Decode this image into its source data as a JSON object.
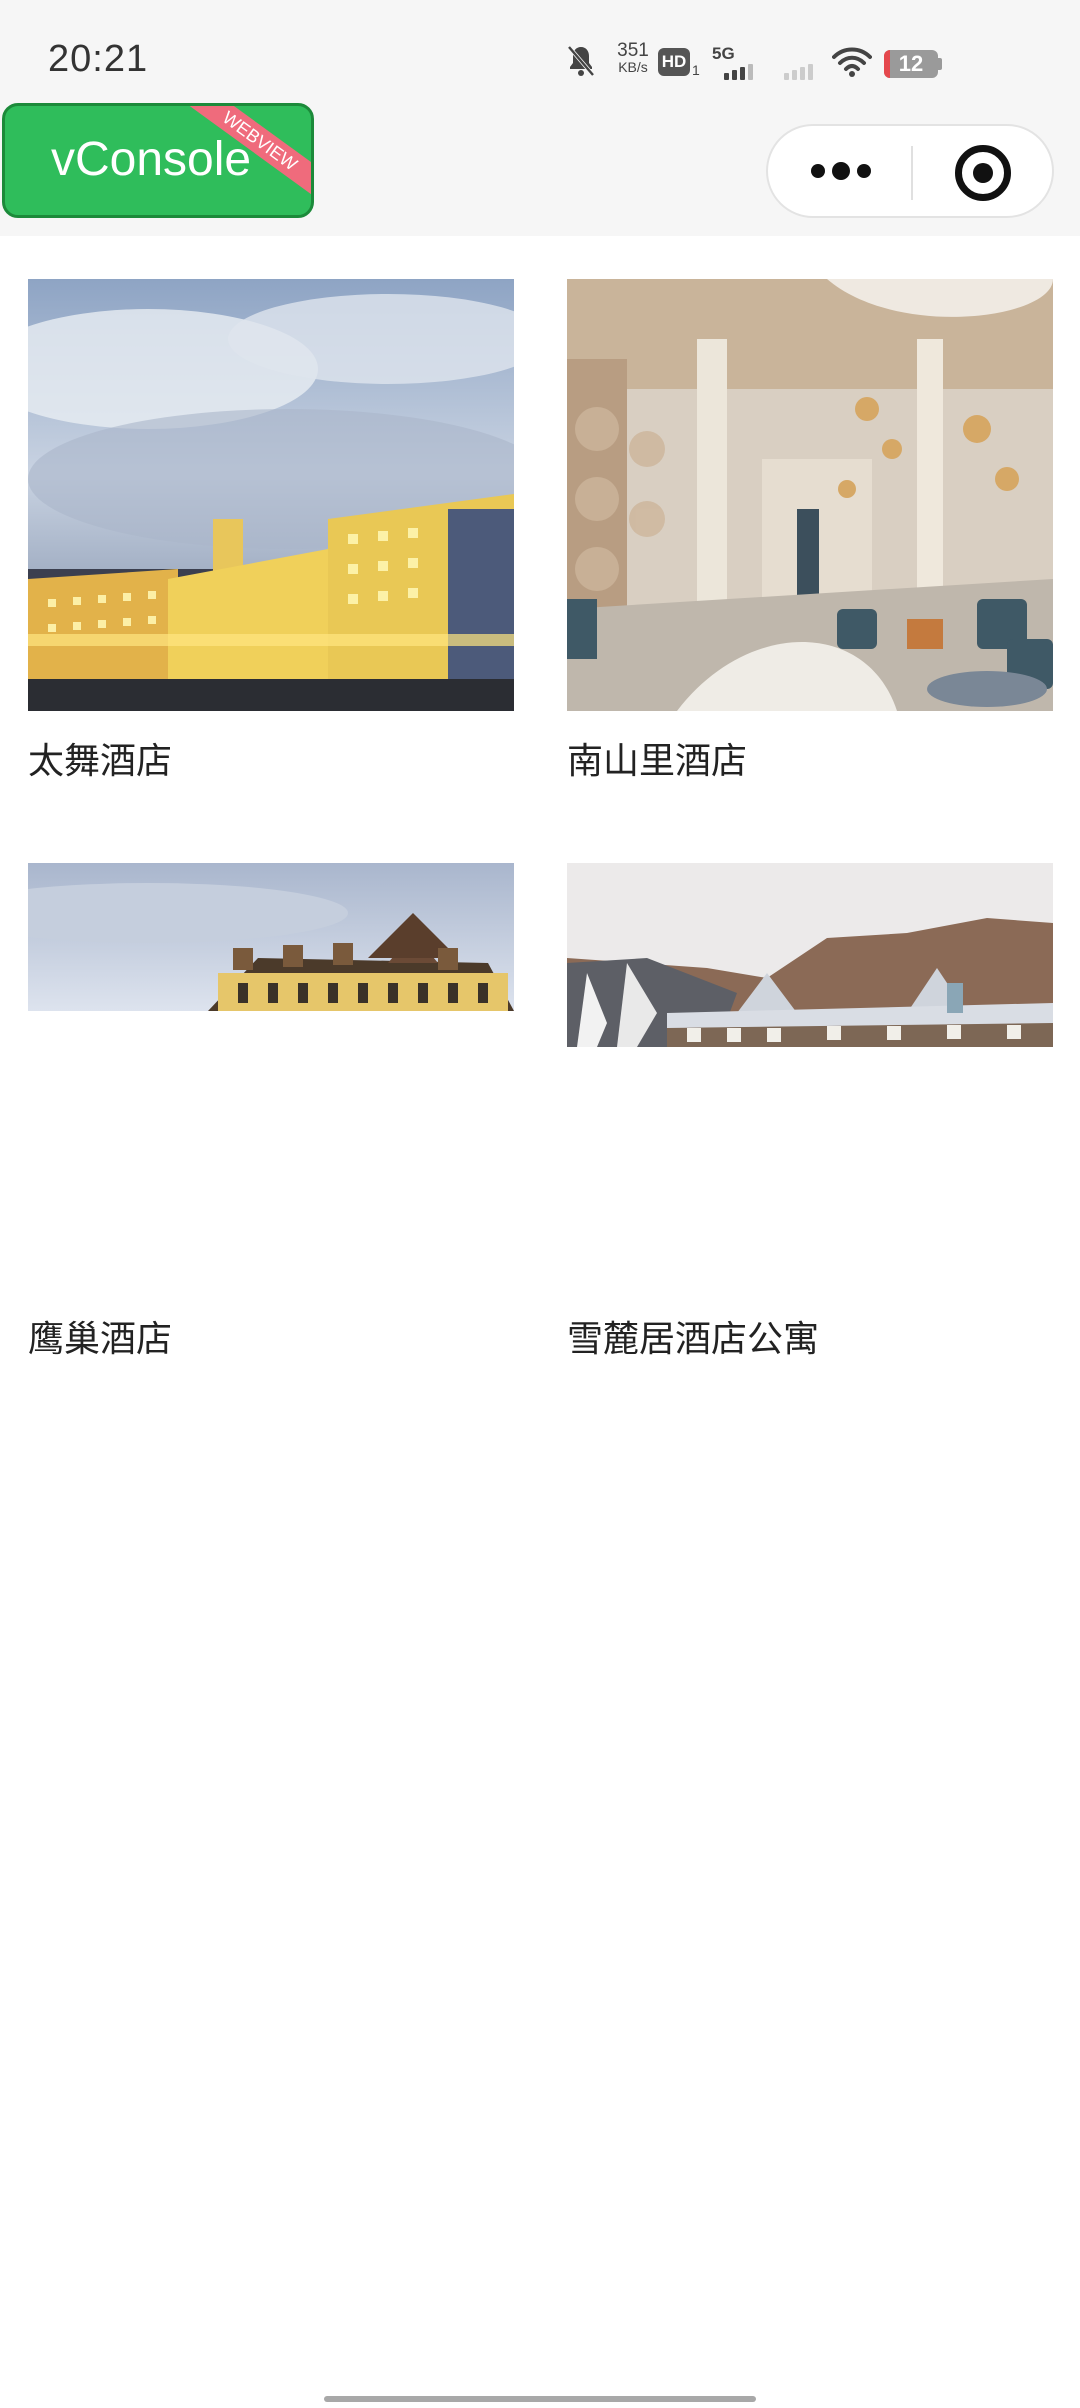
{
  "status_bar": {
    "time": "20:21",
    "net_speed_value": "351",
    "net_speed_unit": "KB/s",
    "hd_label": "HD",
    "hd_sub": "1",
    "network": "5G",
    "battery_level": "12",
    "battery_fraction": 0.12,
    "icons": [
      "mute-bell-icon",
      "signal-icon",
      "wifi-icon",
      "battery-icon"
    ]
  },
  "debug_badge": {
    "label": "vConsole",
    "ribbon": "WEBVIEW",
    "color": "#2fbd5b"
  },
  "capsule": {
    "icons": [
      "more-dots-icon",
      "close-target-icon"
    ]
  },
  "hotels": [
    {
      "name": "太舞酒店",
      "image": "hotel-exterior-night-photo"
    },
    {
      "name": "南山里酒店",
      "image": "hotel-lobby-interior-photo"
    },
    {
      "name": "鹰巢酒店",
      "image": "hotel-building-roof-photo"
    },
    {
      "name": "雪麓居酒店公寓",
      "image": "ski-resort-chalet-photo"
    }
  ]
}
